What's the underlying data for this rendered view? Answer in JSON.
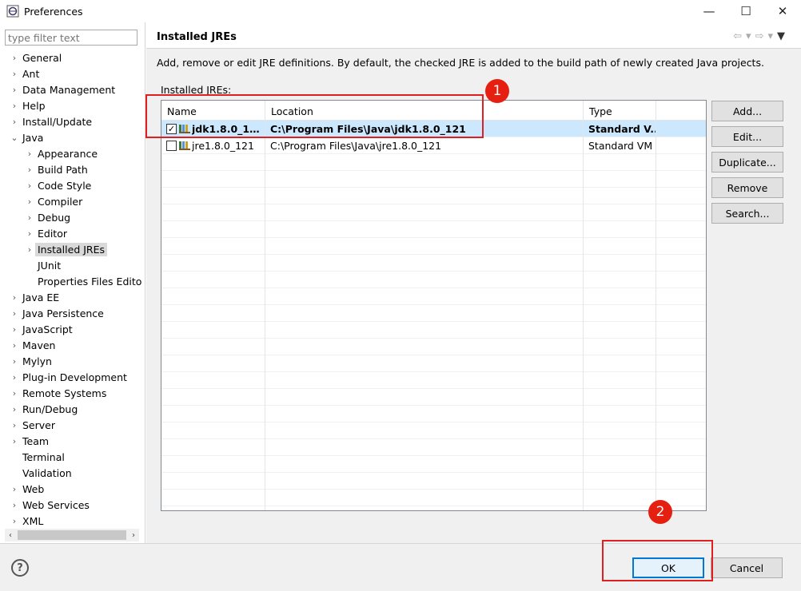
{
  "window": {
    "title": "Preferences",
    "minimize_glyph": "—",
    "maximize_glyph": "☐",
    "close_glyph": "✕"
  },
  "sidebar": {
    "filter_placeholder": "type filter text",
    "items": [
      {
        "label": "General",
        "level": 0,
        "chevron": "›"
      },
      {
        "label": "Ant",
        "level": 0,
        "chevron": "›"
      },
      {
        "label": "Data Management",
        "level": 0,
        "chevron": "›"
      },
      {
        "label": "Help",
        "level": 0,
        "chevron": "›"
      },
      {
        "label": "Install/Update",
        "level": 0,
        "chevron": "›"
      },
      {
        "label": "Java",
        "level": 0,
        "chevron": "⌄"
      },
      {
        "label": "Appearance",
        "level": 1,
        "chevron": "›"
      },
      {
        "label": "Build Path",
        "level": 1,
        "chevron": "›"
      },
      {
        "label": "Code Style",
        "level": 1,
        "chevron": "›"
      },
      {
        "label": "Compiler",
        "level": 1,
        "chevron": "›"
      },
      {
        "label": "Debug",
        "level": 1,
        "chevron": "›"
      },
      {
        "label": "Editor",
        "level": 1,
        "chevron": "›"
      },
      {
        "label": "Installed JREs",
        "level": 1,
        "chevron": "›",
        "selected": true
      },
      {
        "label": "JUnit",
        "level": 1,
        "chevron": ""
      },
      {
        "label": "Properties Files Edito",
        "level": 1,
        "chevron": ""
      },
      {
        "label": "Java EE",
        "level": 0,
        "chevron": "›"
      },
      {
        "label": "Java Persistence",
        "level": 0,
        "chevron": "›"
      },
      {
        "label": "JavaScript",
        "level": 0,
        "chevron": "›"
      },
      {
        "label": "Maven",
        "level": 0,
        "chevron": "›"
      },
      {
        "label": "Mylyn",
        "level": 0,
        "chevron": "›"
      },
      {
        "label": "Plug-in Development",
        "level": 0,
        "chevron": "›"
      },
      {
        "label": "Remote Systems",
        "level": 0,
        "chevron": "›"
      },
      {
        "label": "Run/Debug",
        "level": 0,
        "chevron": "›"
      },
      {
        "label": "Server",
        "level": 0,
        "chevron": "›"
      },
      {
        "label": "Team",
        "level": 0,
        "chevron": "›"
      },
      {
        "label": "Terminal",
        "level": 0,
        "chevron": ""
      },
      {
        "label": "Validation",
        "level": 0,
        "chevron": ""
      },
      {
        "label": "Web",
        "level": 0,
        "chevron": "›"
      },
      {
        "label": "Web Services",
        "level": 0,
        "chevron": "›"
      },
      {
        "label": "XML",
        "level": 0,
        "chevron": "›"
      }
    ],
    "scroll_left": "‹",
    "scroll_right": "›"
  },
  "page": {
    "title": "Installed JREs",
    "description": "Add, remove or edit JRE definitions. By default, the checked JRE is added to the build path of newly created Java projects.",
    "list_label": "Installed JREs:",
    "nav": {
      "back": "⇦",
      "back_menu": "▾",
      "forward": "⇨",
      "forward_menu": "▾",
      "view_menu": "▼"
    }
  },
  "table": {
    "headers": {
      "name": "Name",
      "location": "Location",
      "type": "Type"
    },
    "rows": [
      {
        "checked": true,
        "check_glyph": "✓",
        "name": "jdk1.8.0_121...",
        "location": "C:\\Program Files\\Java\\jdk1.8.0_121",
        "type": "Standard V..."
      },
      {
        "checked": false,
        "check_glyph": "",
        "name": "jre1.8.0_121",
        "location": "C:\\Program Files\\Java\\jre1.8.0_121",
        "type": "Standard VM"
      }
    ]
  },
  "buttons": {
    "add": "Add...",
    "edit": "Edit...",
    "duplicate": "Duplicate...",
    "remove": "Remove",
    "search": "Search...",
    "ok": "OK",
    "cancel": "Cancel",
    "help": "?"
  },
  "annotations": {
    "marker1": "1",
    "marker2": "2",
    "color": "#e62010"
  }
}
